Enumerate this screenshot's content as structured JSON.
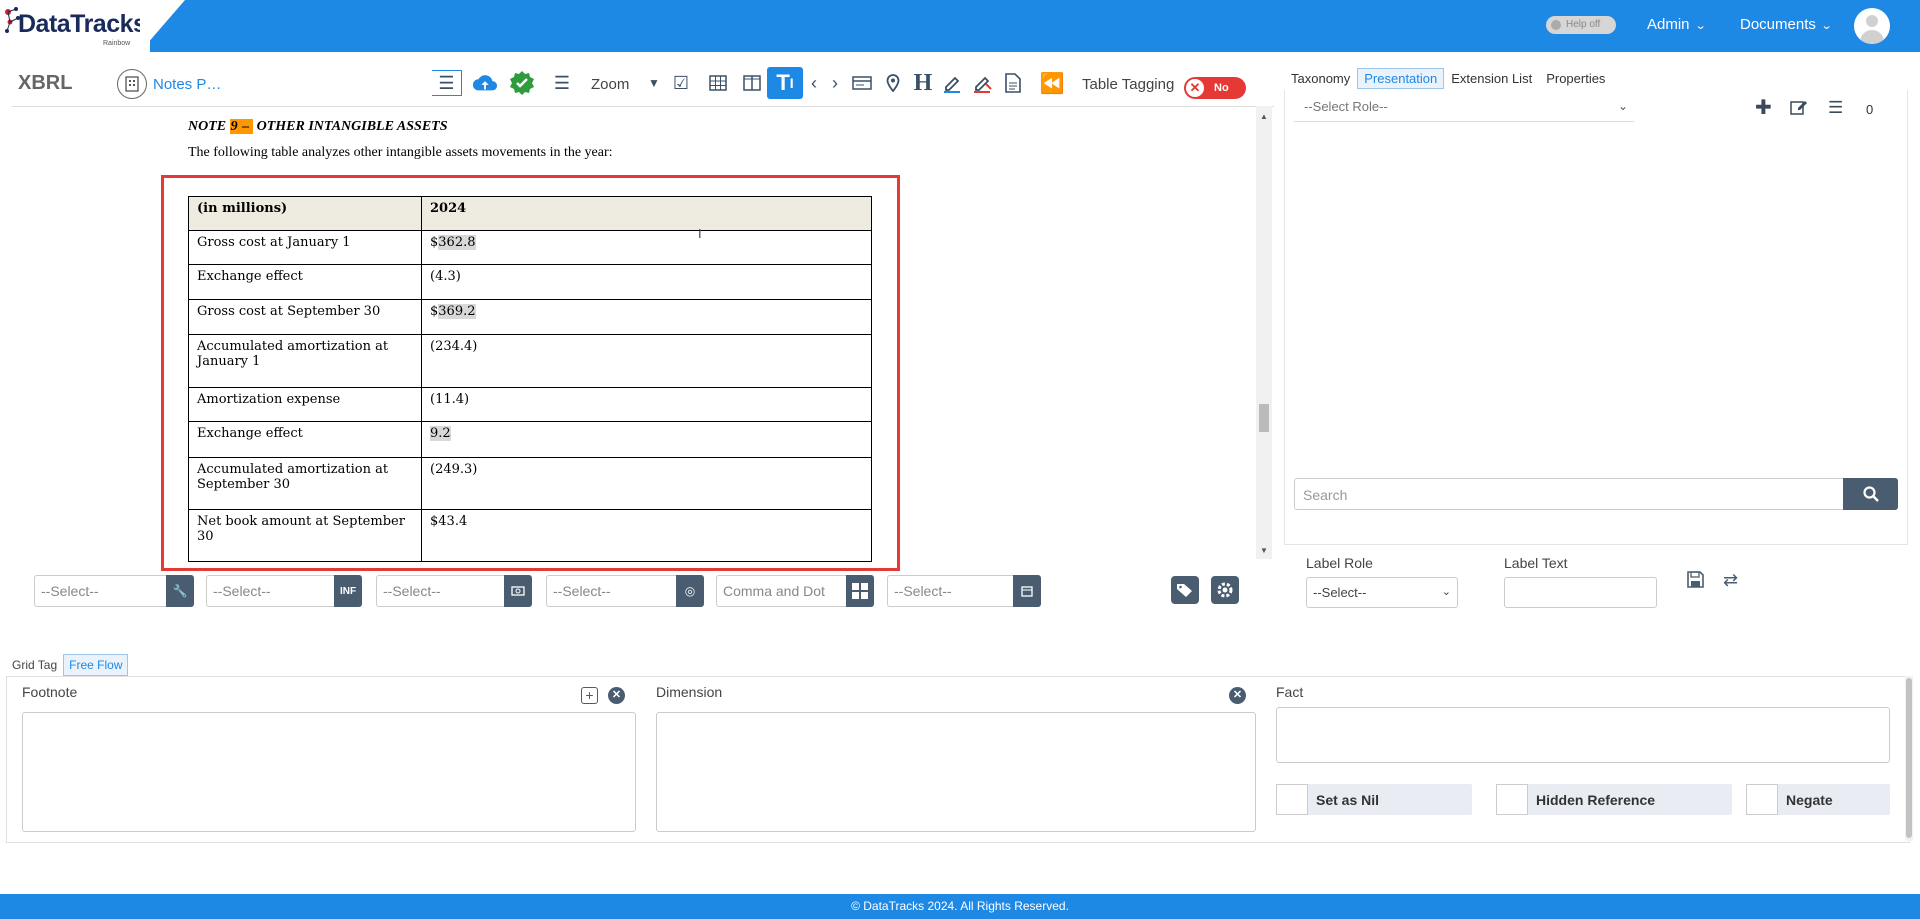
{
  "header": {
    "logo_text": "DataTracks",
    "logo_sub": "Rainbow",
    "help_label": "Help off",
    "admin_label": "Admin",
    "documents_label": "Documents"
  },
  "toolbar": {
    "title": "XBRL",
    "notes_label": "Notes P…",
    "zoom_label": "Zoom",
    "table_tagging_label": "Table Tagging",
    "table_tagging_value": "No"
  },
  "document": {
    "note_prefix": "NOTE ",
    "note_number": "9",
    "note_dash": " – ",
    "note_title": "OTHER INTANGIBLE ASSETS",
    "description": "The following table analyzes other intangible assets movements in the year:",
    "table": {
      "header": [
        "(in millions)",
        "2024"
      ],
      "rows": [
        {
          "label": "Gross cost at January 1",
          "prefix": "$",
          "value": "362.8"
        },
        {
          "label": "Exchange effect",
          "prefix": "",
          "value": "(4.3)"
        },
        {
          "label": "Gross cost at September 30",
          "prefix": "$",
          "value": "369.2"
        },
        {
          "label": "Accumulated amortization at January 1",
          "prefix": "",
          "value": "(234.4)"
        },
        {
          "label": "Amortization expense",
          "prefix": "",
          "value": "(11.4)"
        },
        {
          "label": "Exchange effect",
          "prefix": "",
          "value": "9.2"
        },
        {
          "label": "Accumulated amortization at September 30",
          "prefix": "",
          "value": "(249.3)"
        },
        {
          "label": "Net book amount at September 30",
          "prefix": "",
          "value": "$43.4"
        }
      ]
    }
  },
  "selectors": {
    "s1": "--Select--",
    "s2": "--Select--",
    "s2_btn": "INF",
    "s3": "--Select--",
    "s4": "--Select--",
    "s5": "Comma and Dot",
    "s6": "--Select--"
  },
  "right_panel": {
    "tabs": [
      "Taxonomy",
      "Presentation",
      "Extension List",
      "Properties"
    ],
    "active_tab": "Presentation",
    "role_placeholder": "--Select Role--",
    "count": "0",
    "search_placeholder": "Search",
    "label_role_label": "Label Role",
    "label_role_value": "--Select--",
    "label_text_label": "Label Text"
  },
  "bottom": {
    "tabs": [
      "Grid Tag",
      "Free Flow"
    ],
    "active_tab": "Free Flow",
    "footnote_label": "Footnote",
    "dimension_label": "Dimension",
    "fact_label": "Fact",
    "set_as_nil": "Set as Nil",
    "hidden_reference": "Hidden Reference",
    "negate": "Negate"
  },
  "footer": {
    "text": "© DataTracks 2024. All Rights Reserved."
  },
  "colors": {
    "brand_blue": "#1e88e5",
    "button_slate": "#4a5d70",
    "highlight_orange": "#ff9800",
    "selection_red": "#e53935",
    "toggle_red": "#e53935"
  }
}
